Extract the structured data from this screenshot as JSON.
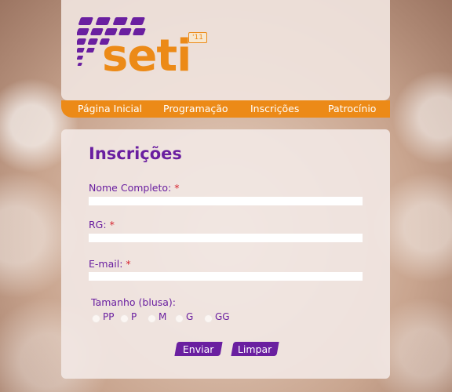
{
  "logo": {
    "word": "seti",
    "year": "'11"
  },
  "nav": {
    "home": "Página Inicial",
    "program": "Programação",
    "signup": "Inscrições",
    "sponsorship": "Patrocínio"
  },
  "form": {
    "title": "Inscrições",
    "name_label": "Nome Completo:",
    "rg_label": "RG:",
    "email_label": "E-mail:",
    "required_mark": "*",
    "name_value": "",
    "rg_value": "",
    "email_value": "",
    "size_label": "Tamanho (blusa):",
    "sizes": [
      "PP",
      "P",
      "M",
      "G",
      "GG"
    ],
    "submit_label": "Enviar",
    "reset_label": "Limpar"
  },
  "colors": {
    "accent_orange": "#ec8a17",
    "accent_purple": "#6a1fa0",
    "required_red": "#d6232e"
  }
}
